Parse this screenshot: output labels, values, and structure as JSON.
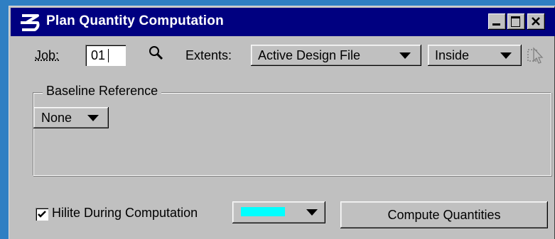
{
  "window": {
    "title": "Plan Quantity Computation",
    "title_bar_color": "#000080"
  },
  "title_buttons": {
    "minimize_icon": "minimize-icon",
    "maximize_icon": "maximize-icon",
    "close_icon": "close-icon"
  },
  "job": {
    "label": "Job:",
    "value": "01"
  },
  "extents": {
    "label": "Extents:",
    "source_selected": "Active Design File",
    "mode_selected": "Inside"
  },
  "baseline": {
    "group_label": "Baseline Reference",
    "selected": "None"
  },
  "hilite": {
    "label": "Hilite During Computation",
    "checked": true,
    "color": "#00ffff"
  },
  "actions": {
    "compute_label": "Compute Quantities"
  },
  "colors": {
    "dialog_bg": "#c0c0c0",
    "desktop": "#2f7fc3"
  }
}
